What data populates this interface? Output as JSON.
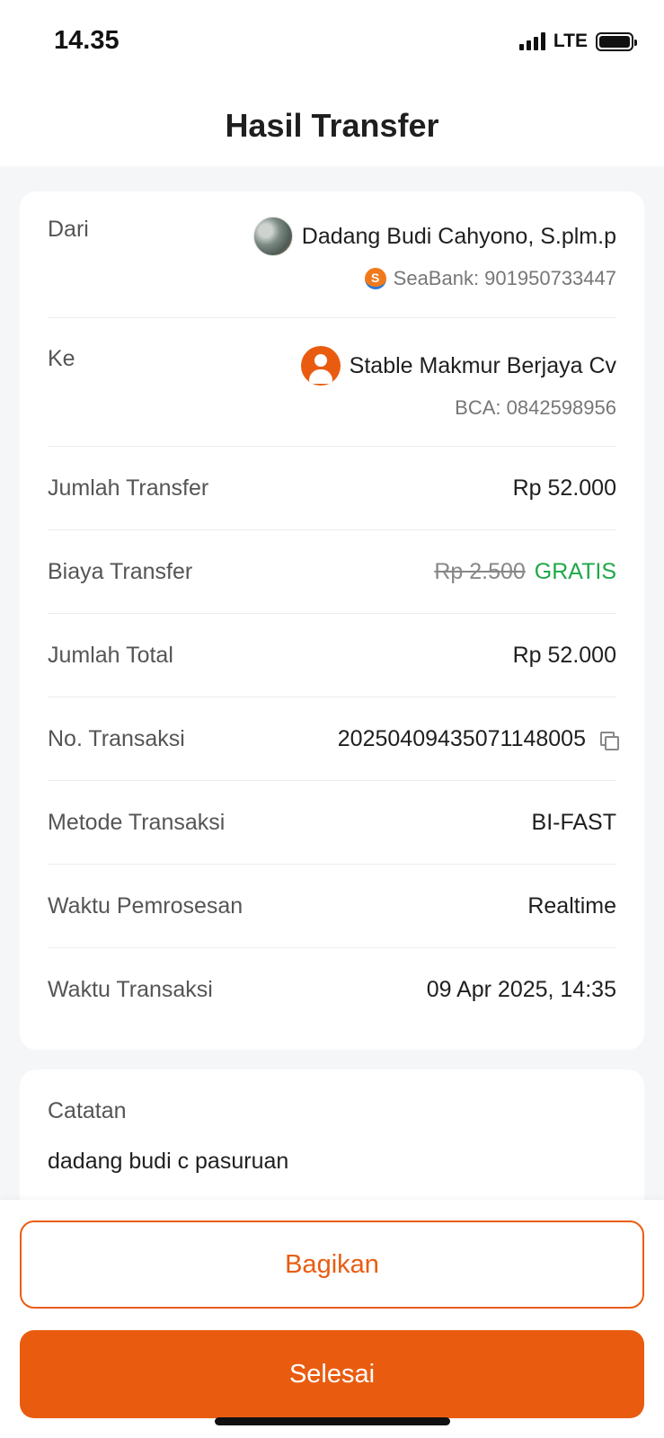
{
  "status_bar": {
    "time": "14.35",
    "network": "LTE"
  },
  "header": {
    "title": "Hasil Transfer"
  },
  "from": {
    "label": "Dari",
    "name": "Dadang Budi Cahyono, S.plm.p",
    "bank": "SeaBank: 901950733447",
    "bank_icon_letter": "S"
  },
  "to": {
    "label": "Ke",
    "name": "Stable Makmur Berjaya Cv",
    "bank": "BCA: 0842598956"
  },
  "details": {
    "amount_label": "Jumlah Transfer",
    "amount_value": "Rp 52.000",
    "fee_label": "Biaya Transfer",
    "fee_original": "Rp 2.500",
    "fee_value": "GRATIS",
    "total_label": "Jumlah Total",
    "total_value": "Rp 52.000",
    "txn_no_label": "No. Transaksi",
    "txn_no_value": "20250409435071148005",
    "method_label": "Metode Transaksi",
    "method_value": "BI-FAST",
    "processing_label": "Waktu Pemrosesan",
    "processing_value": "Realtime",
    "txn_time_label": "Waktu Transaksi",
    "txn_time_value": "09 Apr 2025, 14:35"
  },
  "note": {
    "label": "Catatan",
    "text": "dadang budi c pasuruan"
  },
  "buttons": {
    "share": "Bagikan",
    "done": "Selesai"
  },
  "colors": {
    "accent": "#e95c10",
    "free": "#1fa84a"
  }
}
